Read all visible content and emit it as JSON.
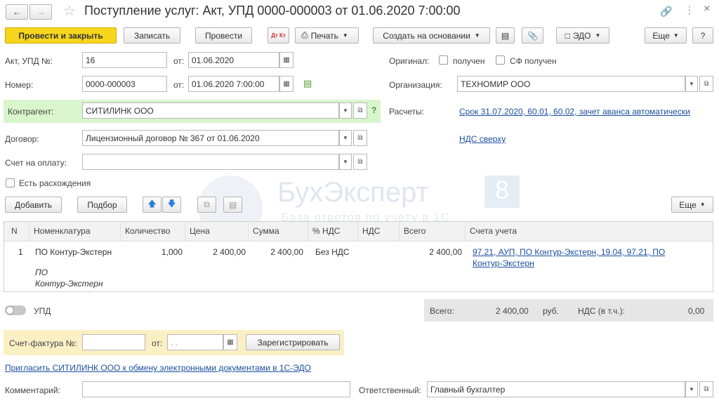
{
  "title": "Поступление услуг: Акт, УПД 0000-000003 от 01.06.2020 7:00:00",
  "toolbar": {
    "post_close": "Провести и закрыть",
    "save": "Записать",
    "post": "Провести",
    "dtkt": "Дт Кт",
    "print": "Печать",
    "create_based": "Создать на основании",
    "edo": "ЭДО",
    "more": "Еще",
    "help": "?"
  },
  "form": {
    "act_label": "Акт, УПД №:",
    "act_value": "16",
    "from_label": "от:",
    "act_date": "01.06.2020",
    "number_label": "Номер:",
    "number_value": "0000-000003",
    "number_date": "01.06.2020  7:00:00",
    "counterparty_label": "Контрагент:",
    "counterparty_value": "СИТИЛИНК ООО",
    "contract_label": "Договор:",
    "contract_value": "Лицензионный договор № 367 от 01.06.2020",
    "invoice_label": "Счет на оплату:",
    "invoice_value": "",
    "discrepancy_label": "Есть расхождения",
    "original_label": "Оригинал:",
    "received_label": "получен",
    "sf_received_label": "СФ получен",
    "org_label": "Организация:",
    "org_value": "ТЕХНОМИР ООО",
    "settlements_label": "Расчеты:",
    "settlements_link": "Срок 31.07.2020, 60.01, 60.02, зачет аванса автоматически",
    "vat_link": "НДС сверху"
  },
  "table_toolbar": {
    "add": "Добавить",
    "select": "Подбор",
    "more": "Еще"
  },
  "table": {
    "headers": [
      "N",
      "Номенклатура",
      "Количество",
      "Цена",
      "Сумма",
      "% НДС",
      "НДС",
      "Всего",
      "Счета учета"
    ],
    "rows": [
      {
        "n": "1",
        "item": "ПО Контур-Экстерн",
        "item_sub1": "ПО",
        "item_sub2": "Контур-Экстерн",
        "qty": "1,000",
        "price": "2 400,00",
        "sum": "2 400,00",
        "vat_rate": "Без НДС",
        "vat": "",
        "total": "2 400,00",
        "accounts_line1": "97.21, АУП, ПО Контур-Экстерн, 19.04, 97.21, ПО",
        "accounts_line2": "Контур-Экстерн"
      }
    ]
  },
  "totals": {
    "upd_label": "УПД",
    "total_label": "Всего:",
    "total_value": "2 400,00",
    "currency": "руб.",
    "vat_label": "НДС (в т.ч.):",
    "vat_value": "0,00"
  },
  "invoice_block": {
    "label": "Счет-фактура №:",
    "number": "",
    "from_label": "от:",
    "date_placeholder": " .  .",
    "register": "Зарегистрировать"
  },
  "edo_link": "Пригласить СИТИЛИНК ООО к обмену электронными документами в 1С-ЭДО",
  "footer": {
    "comment_label": "Комментарий:",
    "comment_value": "",
    "responsible_label": "Ответственный:",
    "responsible_value": "Главный бухгалтер"
  },
  "watermark": {
    "name": "БухЭксперт",
    "digit": "8",
    "tagline": "База ответов по учёту в 1С"
  },
  "colors": {
    "primary_button": "#f7d51c",
    "highlight_green": "#d8f5cc",
    "highlight_yellow": "#fbefc4",
    "link": "#1a4fa0",
    "totals_bg": "#e6e6e6"
  }
}
